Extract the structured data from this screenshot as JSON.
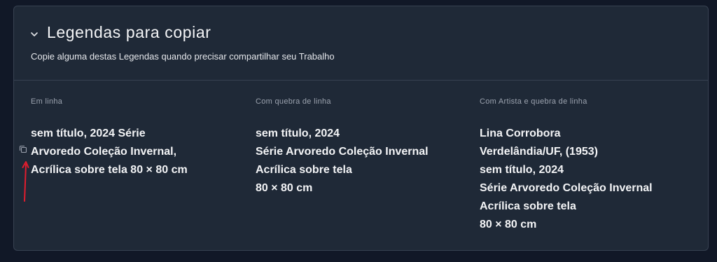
{
  "section": {
    "title": "Legendas para copiar",
    "subtitle": "Copie alguma destas Legendas quando precisar compartilhar seu Trabalho"
  },
  "columns": [
    {
      "label": "Em linha",
      "lines": [
        "sem título, 2024 Série",
        "Arvoredo Coleção Invernal,",
        "Acrílica sobre tela 80 × 80 cm"
      ]
    },
    {
      "label": "Com quebra de linha",
      "lines": [
        "sem título, 2024",
        "Série Arvoredo Coleção Invernal",
        "Acrílica sobre tela",
        "80 × 80 cm"
      ]
    },
    {
      "label": "Com Artista e quebra de linha",
      "lines": [
        "Lina Corrobora",
        "Verdelândia/UF, (1953)",
        "sem título, 2024",
        "Série Arvoredo Coleção Invernal",
        "Acrílica sobre tela",
        "80 × 80 cm"
      ]
    }
  ],
  "icons": {
    "chevron": "chevron-down-icon",
    "copy": "copy-icon",
    "annotation_arrow": "red-arrow"
  },
  "colors": {
    "background": "#111827",
    "panel": "#1f2937",
    "border": "#374151",
    "text": "#f3f4f6",
    "muted": "#9ca3af",
    "annotation": "#e11d2e"
  }
}
